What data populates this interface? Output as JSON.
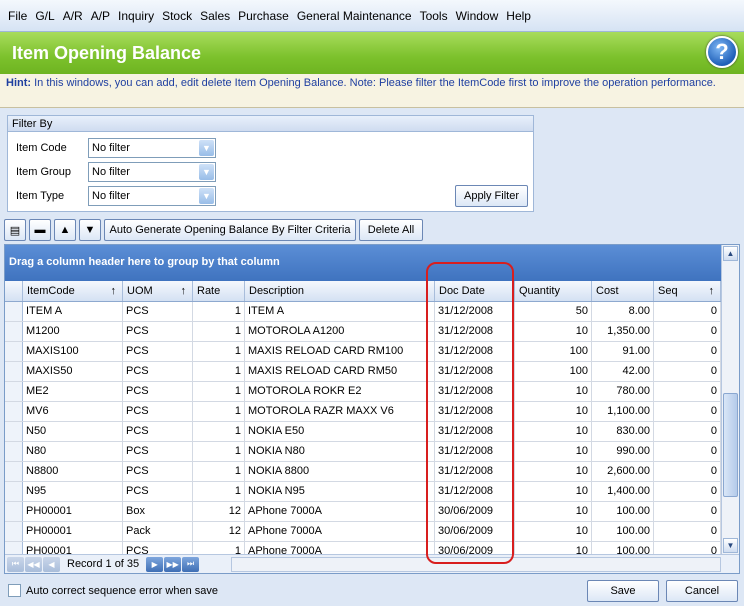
{
  "menu": [
    "File",
    "G/L",
    "A/R",
    "A/P",
    "Inquiry",
    "Stock",
    "Sales",
    "Purchase",
    "General Maintenance",
    "Tools",
    "Window",
    "Help"
  ],
  "title": "Item Opening Balance",
  "help_glyph": "?",
  "hint": {
    "label": "Hint:",
    "text": "In this windows, you can add, edit  delete Item Opening Balance. Note: Please filter the ItemCode first to improve the operation performance."
  },
  "filter": {
    "header": "Filter By",
    "item_code_label": "Item Code",
    "item_code_value": "No filter",
    "item_group_label": "Item Group",
    "item_group_value": "No filter",
    "item_type_label": "Item Type",
    "item_type_value": "No filter",
    "apply_label": "Apply Filter"
  },
  "toolbar": {
    "auto_generate_label": "Auto Generate Opening Balance By Filter Criteria",
    "delete_all_label": "Delete All"
  },
  "grid": {
    "group_hint": "Drag a column header here to group by that column",
    "columns": [
      "ItemCode",
      "UOM",
      "Rate",
      "Description",
      "Doc Date",
      "Quantity",
      "Cost",
      "Seq"
    ],
    "rows": [
      [
        "ITEM A",
        "PCS",
        "1",
        "ITEM A",
        "31/12/2008",
        "50",
        "8.00",
        "0"
      ],
      [
        "M1200",
        "PCS",
        "1",
        "MOTOROLA A1200",
        "31/12/2008",
        "10",
        "1,350.00",
        "0"
      ],
      [
        "MAXIS100",
        "PCS",
        "1",
        "MAXIS RELOAD CARD RM100",
        "31/12/2008",
        "100",
        "91.00",
        "0"
      ],
      [
        "MAXIS50",
        "PCS",
        "1",
        "MAXIS RELOAD CARD RM50",
        "31/12/2008",
        "100",
        "42.00",
        "0"
      ],
      [
        "ME2",
        "PCS",
        "1",
        "MOTOROLA ROKR E2",
        "31/12/2008",
        "10",
        "780.00",
        "0"
      ],
      [
        "MV6",
        "PCS",
        "1",
        "MOTOROLA RAZR MAXX V6",
        "31/12/2008",
        "10",
        "1,100.00",
        "0"
      ],
      [
        "N50",
        "PCS",
        "1",
        "NOKIA E50",
        "31/12/2008",
        "10",
        "830.00",
        "0"
      ],
      [
        "N80",
        "PCS",
        "1",
        "NOKIA N80",
        "31/12/2008",
        "10",
        "990.00",
        "0"
      ],
      [
        "N8800",
        "PCS",
        "1",
        "NOKIA 8800",
        "31/12/2008",
        "10",
        "2,600.00",
        "0"
      ],
      [
        "N95",
        "PCS",
        "1",
        "NOKIA N95",
        "31/12/2008",
        "10",
        "1,400.00",
        "0"
      ],
      [
        "PH00001",
        "Box",
        "12",
        "APhone 7000A",
        "30/06/2009",
        "10",
        "100.00",
        "0"
      ],
      [
        "PH00001",
        "Pack",
        "12",
        "APhone 7000A",
        "30/06/2009",
        "10",
        "100.00",
        "0"
      ],
      [
        "PH00001",
        "PCS",
        "1",
        "APhone 7000A",
        "30/06/2009",
        "10",
        "100.00",
        "0"
      ]
    ],
    "record_text": "Record 1 of 35"
  },
  "bottom": {
    "auto_correct_label": "Auto correct sequence error when save",
    "save_label": "Save",
    "cancel_label": "Cancel"
  }
}
